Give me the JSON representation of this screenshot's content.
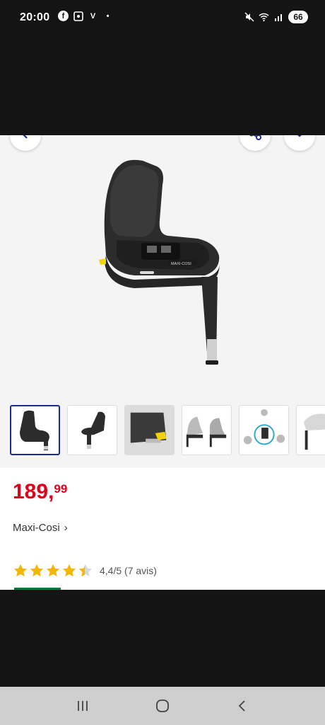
{
  "status_bar": {
    "time": "20:00",
    "battery": "66",
    "left_icons": [
      "facebook-icon",
      "screenshot-icon",
      "v-app-icon",
      "dot-icon"
    ],
    "right_icons": [
      "mute-icon",
      "wifi-icon",
      "signal-icon"
    ]
  },
  "product": {
    "image_icons": [
      "back-arrow-icon",
      "share-icon",
      "heart-icon"
    ],
    "thumbnails": [
      {
        "name": "thumb-base-front",
        "selected": true
      },
      {
        "name": "thumb-base-side",
        "selected": false
      },
      {
        "name": "thumb-base-detail",
        "selected": false
      },
      {
        "name": "thumb-base-seats",
        "selected": false
      },
      {
        "name": "thumb-base-compatible",
        "selected": false
      },
      {
        "name": "thumb-base-car",
        "selected": false
      }
    ]
  },
  "info": {
    "price_int": "189",
    "price_comma": ",",
    "price_dec": "99",
    "brand": "Maxi-Cosi",
    "rating_value": 4.4,
    "rating_text": "4,4/5 (7 avis)",
    "price_color": "#e1001a",
    "star_color": "#f2b705"
  },
  "nav": {
    "icons": [
      "recent-apps-icon",
      "home-icon",
      "back-icon"
    ]
  }
}
